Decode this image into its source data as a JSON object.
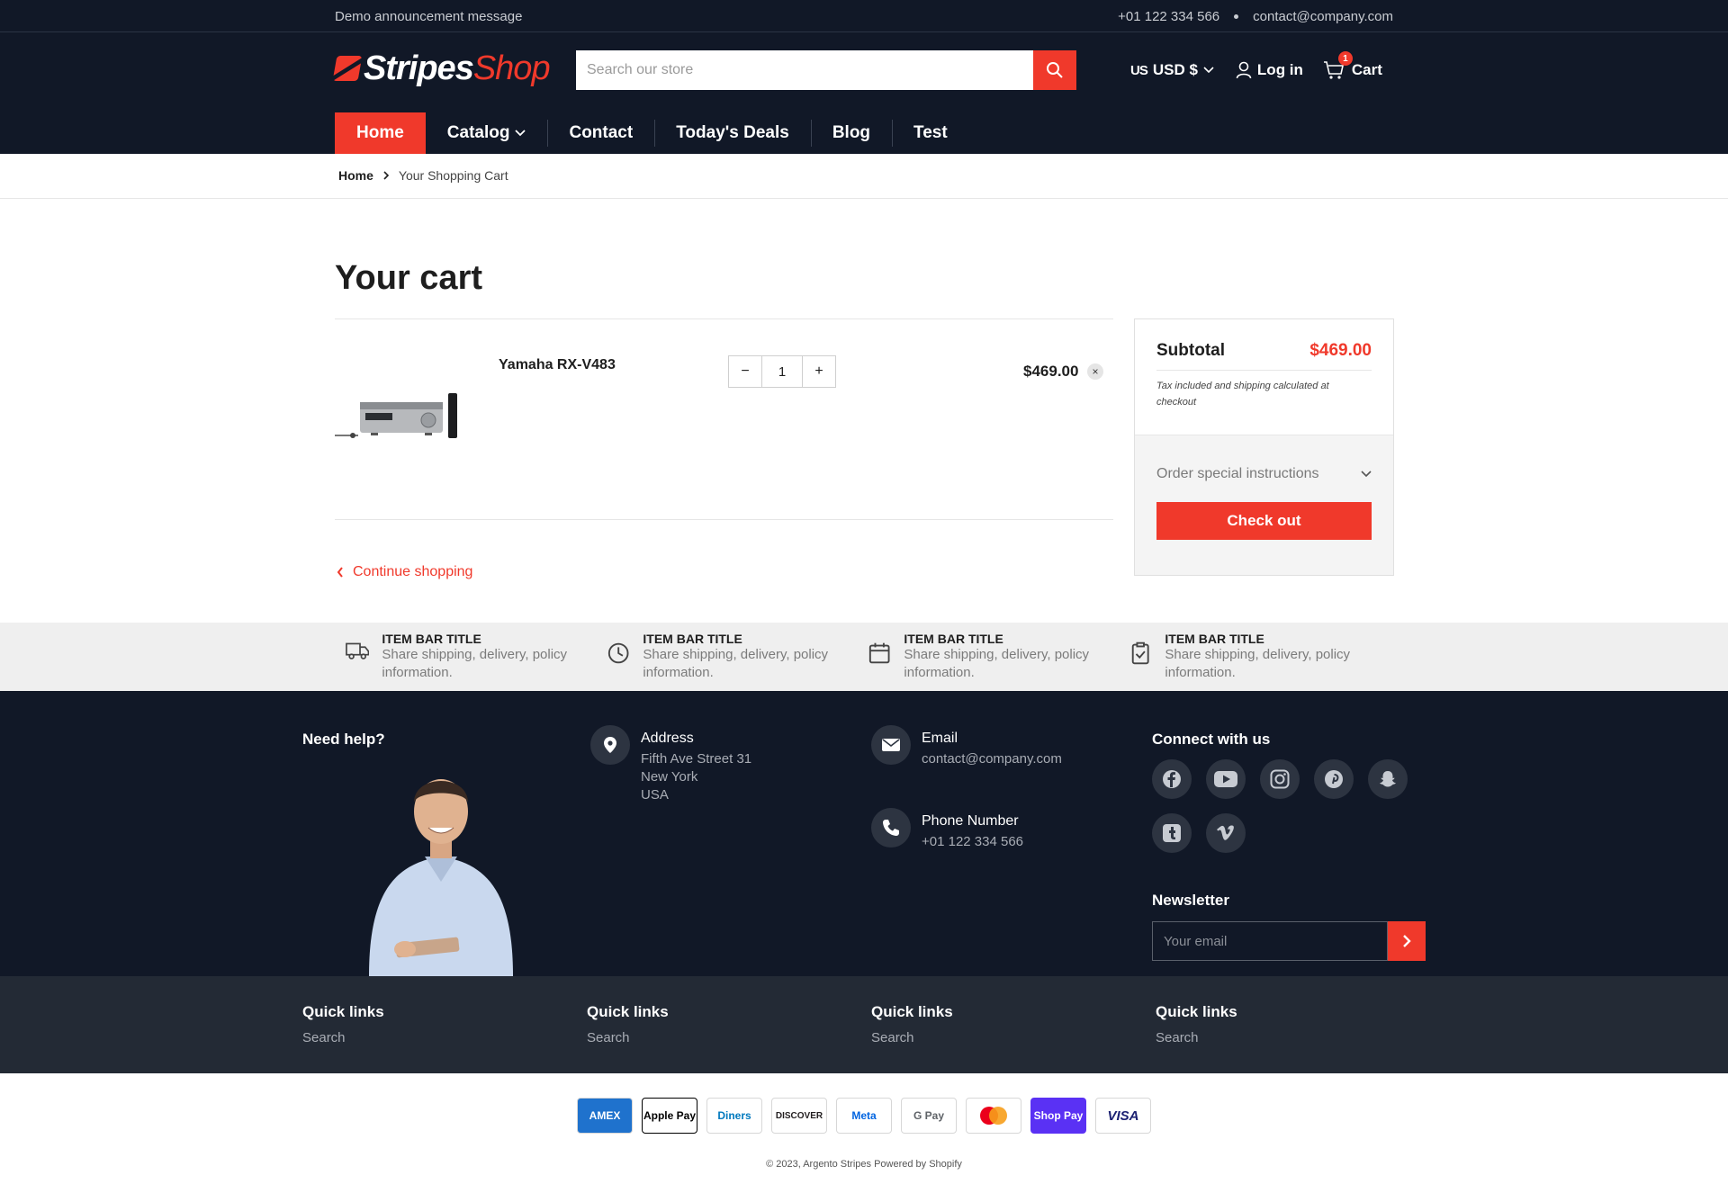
{
  "announcement": {
    "message": "Demo announcement message",
    "phone": "+01 122 334 566",
    "email": "contact@company.com"
  },
  "header": {
    "logo_part1": "Stripes",
    "logo_part2": "Shop",
    "search_placeholder": "Search our store",
    "currency_flag": "US",
    "currency": "USD $",
    "login": "Log in",
    "cart": "Cart",
    "cart_count": "1"
  },
  "nav": {
    "items": [
      {
        "label": "Home",
        "active": true
      },
      {
        "label": "Catalog",
        "dropdown": true
      },
      {
        "label": "Contact"
      },
      {
        "label": "Today's Deals"
      },
      {
        "label": "Blog"
      },
      {
        "label": "Test"
      }
    ]
  },
  "breadcrumb": {
    "home": "Home",
    "current": "Your Shopping Cart"
  },
  "cart": {
    "title": "Your cart",
    "items": [
      {
        "name": "Yamaha RX-V483",
        "quantity": "1",
        "price": "$469.00"
      }
    ],
    "continue": "Continue shopping",
    "qty_minus": "−",
    "qty_plus": "+",
    "remove": "×"
  },
  "summary": {
    "subtotal_label": "Subtotal",
    "subtotal": "$469.00",
    "note": "Tax included and shipping calculated at checkout",
    "instructions": "Order special instructions",
    "checkout": "Check out"
  },
  "itembar": [
    {
      "icon": "truck-icon",
      "title": "ITEM BAR TITLE",
      "desc": "Share shipping, delivery, policy information."
    },
    {
      "icon": "clock-icon",
      "title": "ITEM BAR TITLE",
      "desc": "Share shipping, delivery, policy information."
    },
    {
      "icon": "calendar-icon",
      "title": "ITEM BAR TITLE",
      "desc": "Share shipping, delivery, policy information."
    },
    {
      "icon": "clipboard-icon",
      "title": "ITEM BAR TITLE",
      "desc": "Share shipping, delivery, policy information."
    }
  ],
  "footer": {
    "help": "Need help?",
    "address_title": "Address",
    "address_lines": [
      "Fifth Ave Street 31",
      "New York",
      "USA"
    ],
    "email_title": "Email",
    "email": "contact@company.com",
    "phone_title": "Phone Number",
    "phone": "+01 122 334 566",
    "connect": "Connect with us",
    "socials": [
      "facebook-icon",
      "youtube-icon",
      "instagram-icon",
      "pinterest-icon",
      "snapchat-icon",
      "tumblr-icon",
      "vimeo-icon"
    ],
    "newsletter": "Newsletter",
    "newsletter_placeholder": "Your email"
  },
  "quick_links": [
    {
      "title": "Quick links",
      "link": "Search"
    },
    {
      "title": "Quick links",
      "link": "Search"
    },
    {
      "title": "Quick links",
      "link": "Search"
    },
    {
      "title": "Quick links",
      "link": "Search"
    }
  ],
  "payments": [
    "AMEX",
    "Apple Pay",
    "Diners",
    "DISCOVER",
    "Meta",
    "G Pay",
    "Mastercard",
    "Shop Pay",
    "VISA"
  ],
  "copyright": "© 2023, Argento Stripes Powered by Shopify",
  "colors": {
    "accent": "#f0392b",
    "dark": "#111827",
    "footer_bottom": "#232a35"
  }
}
